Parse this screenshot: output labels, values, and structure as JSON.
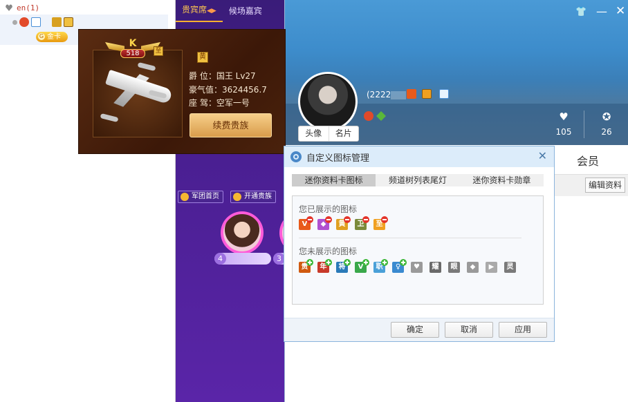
{
  "tree": {
    "row1_text": "en(1)",
    "gold_card_label": "金卡"
  },
  "vip": {
    "tabs": [
      {
        "label": "贵宾席"
      },
      {
        "label": "候场嘉宾"
      }
    ],
    "buttons": {
      "army_home": "军团首页",
      "open_noble": "开通贵族"
    },
    "ranks": [
      "4",
      "3"
    ]
  },
  "noble_card": {
    "level_badge": "518",
    "badge_letter": "K",
    "zhi_badge": "至",
    "title_icon": "黄",
    "lines": [
      "爵    位：国王 Lv27",
      "豪气值：3624456.7",
      "座    驾：空军一号"
    ],
    "renew_button": "续费贵族"
  },
  "profile": {
    "uid_prefix": "(2222",
    "avatar_tabs": [
      "头像",
      "名片"
    ],
    "likes": "105",
    "medals": "26",
    "member_label": "会员",
    "edit_button": "编辑资料",
    "window_icons": [
      "skin-icon",
      "minimize-icon",
      "close-icon"
    ]
  },
  "dialog": {
    "title": "自定义图标管理",
    "tabs": [
      "迷你资料卡图标",
      "频道树列表尾灯",
      "迷你资料卡勋章"
    ],
    "shown_label": "您已展示的图标",
    "hidden_label": "您未展示的图标",
    "shown_icons": [
      {
        "glyph": "V",
        "color": "#e85a1a"
      },
      {
        "glyph": "◆",
        "color": "#b050d0"
      },
      {
        "glyph": "黄",
        "color": "#e0a020"
      },
      {
        "glyph": "卫",
        "color": "#7a8a3a"
      },
      {
        "glyph": "至",
        "color": "#f0a020"
      }
    ],
    "hidden_icons": [
      {
        "glyph": "贵",
        "color": "#d05a10",
        "add": true
      },
      {
        "glyph": "年",
        "color": "#c83a2a",
        "add": true
      },
      {
        "glyph": "将",
        "color": "#2a7ab8",
        "add": true
      },
      {
        "glyph": "V",
        "color": "#3aa84a",
        "add": true
      },
      {
        "glyph": "职",
        "color": "#4aa0d8",
        "add": true
      },
      {
        "glyph": "♀",
        "color": "#3a8ad0",
        "add": true
      },
      {
        "glyph": "♥",
        "color": "#9a9a9a",
        "add": false
      },
      {
        "glyph": "耀",
        "color": "#6a6a6a",
        "add": false
      },
      {
        "glyph": "眼",
        "color": "#7a7a7a",
        "add": false
      },
      {
        "glyph": "◆",
        "color": "#9a9a9a",
        "add": false
      },
      {
        "glyph": "▶",
        "color": "#aaaaaa",
        "add": false
      },
      {
        "glyph": "灵",
        "color": "#7a7a7a",
        "add": false
      }
    ],
    "ok_button": "确定",
    "cancel_button": "取消",
    "apply_button": "应用"
  },
  "colors": {
    "vip_purple": "#4a1f92",
    "banner_blue": "#4a9ad6",
    "gold": "#f0c040",
    "dialog_title_bg": "#dcecfa"
  }
}
